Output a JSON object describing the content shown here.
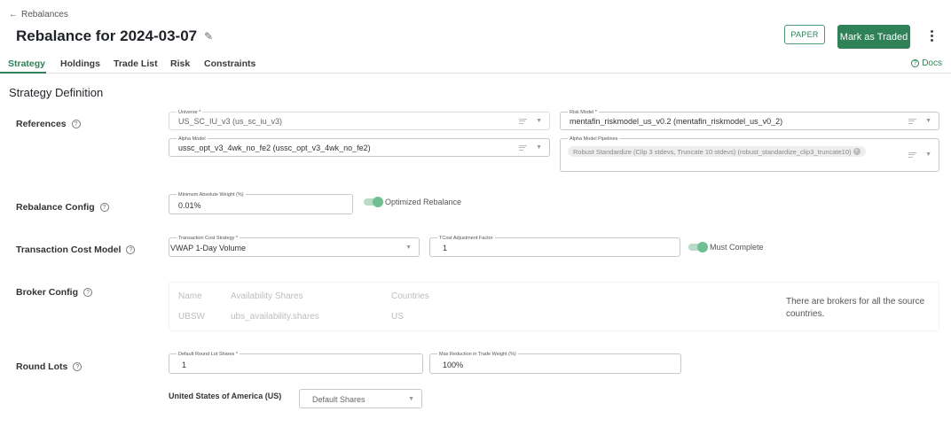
{
  "header": {
    "back_label": "Rebalances",
    "title": "Rebalance for 2024-03-07",
    "paper_label": "PAPER",
    "mark_traded_label": "Mark as Traded"
  },
  "tabs": [
    {
      "label": "Strategy",
      "active": true
    },
    {
      "label": "Holdings",
      "active": false
    },
    {
      "label": "Trade List",
      "active": false
    },
    {
      "label": "Risk",
      "active": false
    },
    {
      "label": "Constraints",
      "active": false
    }
  ],
  "docs_label": "Docs",
  "section_title": "Strategy Definition",
  "references": {
    "label": "References",
    "universe": {
      "label": "Universe *",
      "value": "US_SC_IU_v3 (us_sc_iu_v3)"
    },
    "risk_model": {
      "label": "Risk Model *",
      "value": "mentafin_riskmodel_us_v0.2 (mentafin_riskmodel_us_v0_2)"
    },
    "alpha_model": {
      "label": "Alpha Model",
      "value": "ussc_opt_v3_4wk_no_fe2 (ussc_opt_v3_4wk_no_fe2)"
    },
    "alpha_pipelines": {
      "label": "Alpha Model Pipelines",
      "chip": "Robust Standardize (Clip 3 stdevs, Truncate 10 stdevs) (robust_standardize_clip3_truncate10)"
    }
  },
  "rebalance_config": {
    "label": "Rebalance Config",
    "min_weight": {
      "label": "Minimum Absolute Weight (%)",
      "value": "0.01%"
    },
    "toggle_label": "Optimized Rebalance"
  },
  "transaction_cost": {
    "label": "Transaction Cost Model",
    "strategy": {
      "label": "Transaction Cost Strategy *",
      "value": "VWAP 1-Day Volume"
    },
    "adjustment": {
      "label": "TCost Adjustment Factor",
      "value": "1"
    },
    "toggle_label": "Must Complete"
  },
  "broker_config": {
    "label": "Broker Config",
    "columns": [
      "Name",
      "Availability Shares",
      "Countries"
    ],
    "rows": [
      [
        "UBSW",
        "ubs_availability.shares",
        "US"
      ]
    ],
    "note": "There are brokers for all the source countries."
  },
  "round_lots": {
    "label": "Round Lots",
    "default_shares": {
      "label": "Default Round Lot Shares *",
      "value": "1"
    },
    "max_reduction": {
      "label": "Max Reduction in Trade Weight (%)",
      "value": "100%"
    },
    "country_label": "United States of America (US)",
    "country_select": "Default Shares"
  },
  "colors": {
    "accent": "#2f8157",
    "accent_light": "#6fbf93"
  }
}
